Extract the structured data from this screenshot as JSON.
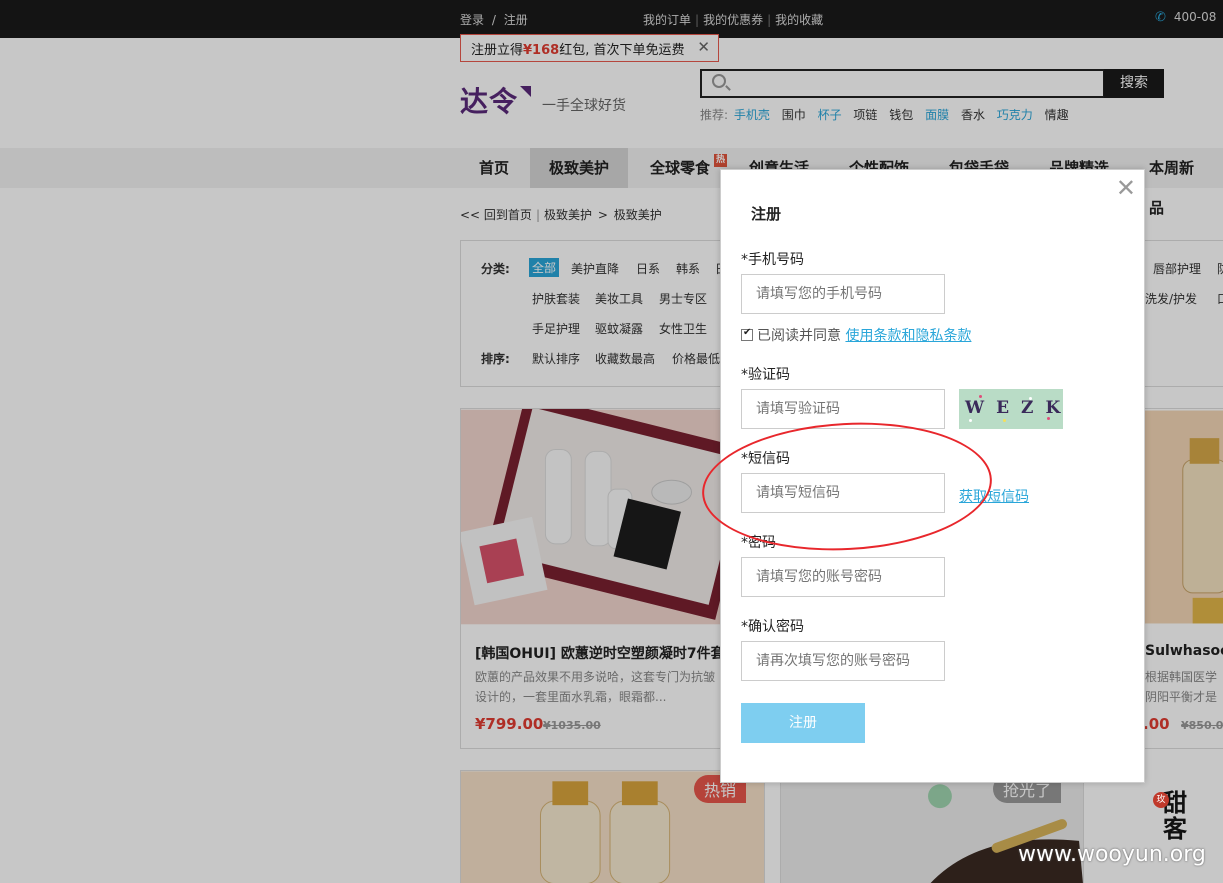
{
  "topbar": {
    "login": "登录",
    "slash": "/",
    "register": "注册",
    "links": [
      "我的订单",
      "我的优惠券",
      "我的收藏"
    ],
    "phone": "400-08"
  },
  "promo": {
    "prefix": "注册立得",
    "amount": "¥168",
    "suffix": "红包, 首次下单免运费",
    "close": "✕"
  },
  "brand": {
    "logo": "达令",
    "slogan": "一手全球好货"
  },
  "search": {
    "button": "搜索",
    "hot_label": "推荐:",
    "hot_words": [
      {
        "text": "手机壳",
        "hl": true
      },
      {
        "text": "围巾",
        "hl": false
      },
      {
        "text": "杯子",
        "hl": true
      },
      {
        "text": "项链",
        "hl": false
      },
      {
        "text": "钱包",
        "hl": false
      },
      {
        "text": "面膜",
        "hl": true
      },
      {
        "text": "香水",
        "hl": false
      },
      {
        "text": "巧克力",
        "hl": true
      },
      {
        "text": "情趣",
        "hl": false
      }
    ]
  },
  "nav": {
    "items": [
      "首页",
      "极致美护",
      "全球零食",
      "创意生活",
      "个性配饰",
      "包袋手袋",
      "品牌精选",
      "本周新品"
    ],
    "badge": "热"
  },
  "breadcrumb": {
    "back": "<< 回到首页",
    "level1": "极致美护",
    "arrow": ">",
    "level2": "极致美护",
    "sep": "|"
  },
  "filter": {
    "category_label": "分类:",
    "sort_label": "排序:",
    "row1": [
      "全部",
      "美护直降",
      "日系",
      "韩系",
      "日"
    ],
    "row1_right": [
      "唇部护理",
      "防"
    ],
    "row2": [
      "护肤套装",
      "美妆工具",
      "男士专区"
    ],
    "row2_right": [
      "洗发/护发",
      "口"
    ],
    "row3": [
      "手足护理",
      "驱蚊凝露",
      "女性卫生"
    ],
    "sort": [
      "默认排序",
      "收藏数最高",
      "价格最低"
    ]
  },
  "products": [
    {
      "tag": "热",
      "name": "[韩国OHUI] 欧蕙逆时空塑颜凝时7件套",
      "desc": "欧蕙的产品效果不用多说哈，这套专门为抗皱设计的，一套里面水乳霜，眼霜都...",
      "price": "¥799.00",
      "old_price": "¥1035.00"
    },
    {
      "name": "Sulwhasoo]",
      "desc": "根据韩国医学\n阴阳平衡才是",
      "price": ".00",
      "old_price": "¥850.0"
    },
    {
      "tag": "热销"
    },
    {
      "tag": "抢光了"
    }
  ],
  "modal": {
    "title": "注册",
    "close": "✕",
    "phone_label": "*手机号码",
    "phone_placeholder": "请填写您的手机号码",
    "agree_text": "已阅读并同意",
    "agree_link": "使用条款和隐私条款",
    "captcha_label": "*验证码",
    "captcha_placeholder": "请填写验证码",
    "captcha_text": "WEZK",
    "sms_label": "*短信码",
    "sms_placeholder": "请填写短信码",
    "sms_button": "获取短信码",
    "password_label": "*密码",
    "password_placeholder": "请填写您的账号密码",
    "confirm_label": "*确认密码",
    "confirm_placeholder": "请再次填写您的账号密码",
    "submit": "注册"
  },
  "watermark": {
    "text": "www.wooyun.org",
    "logo": "甜\n客",
    "logo_badge": "玫"
  }
}
